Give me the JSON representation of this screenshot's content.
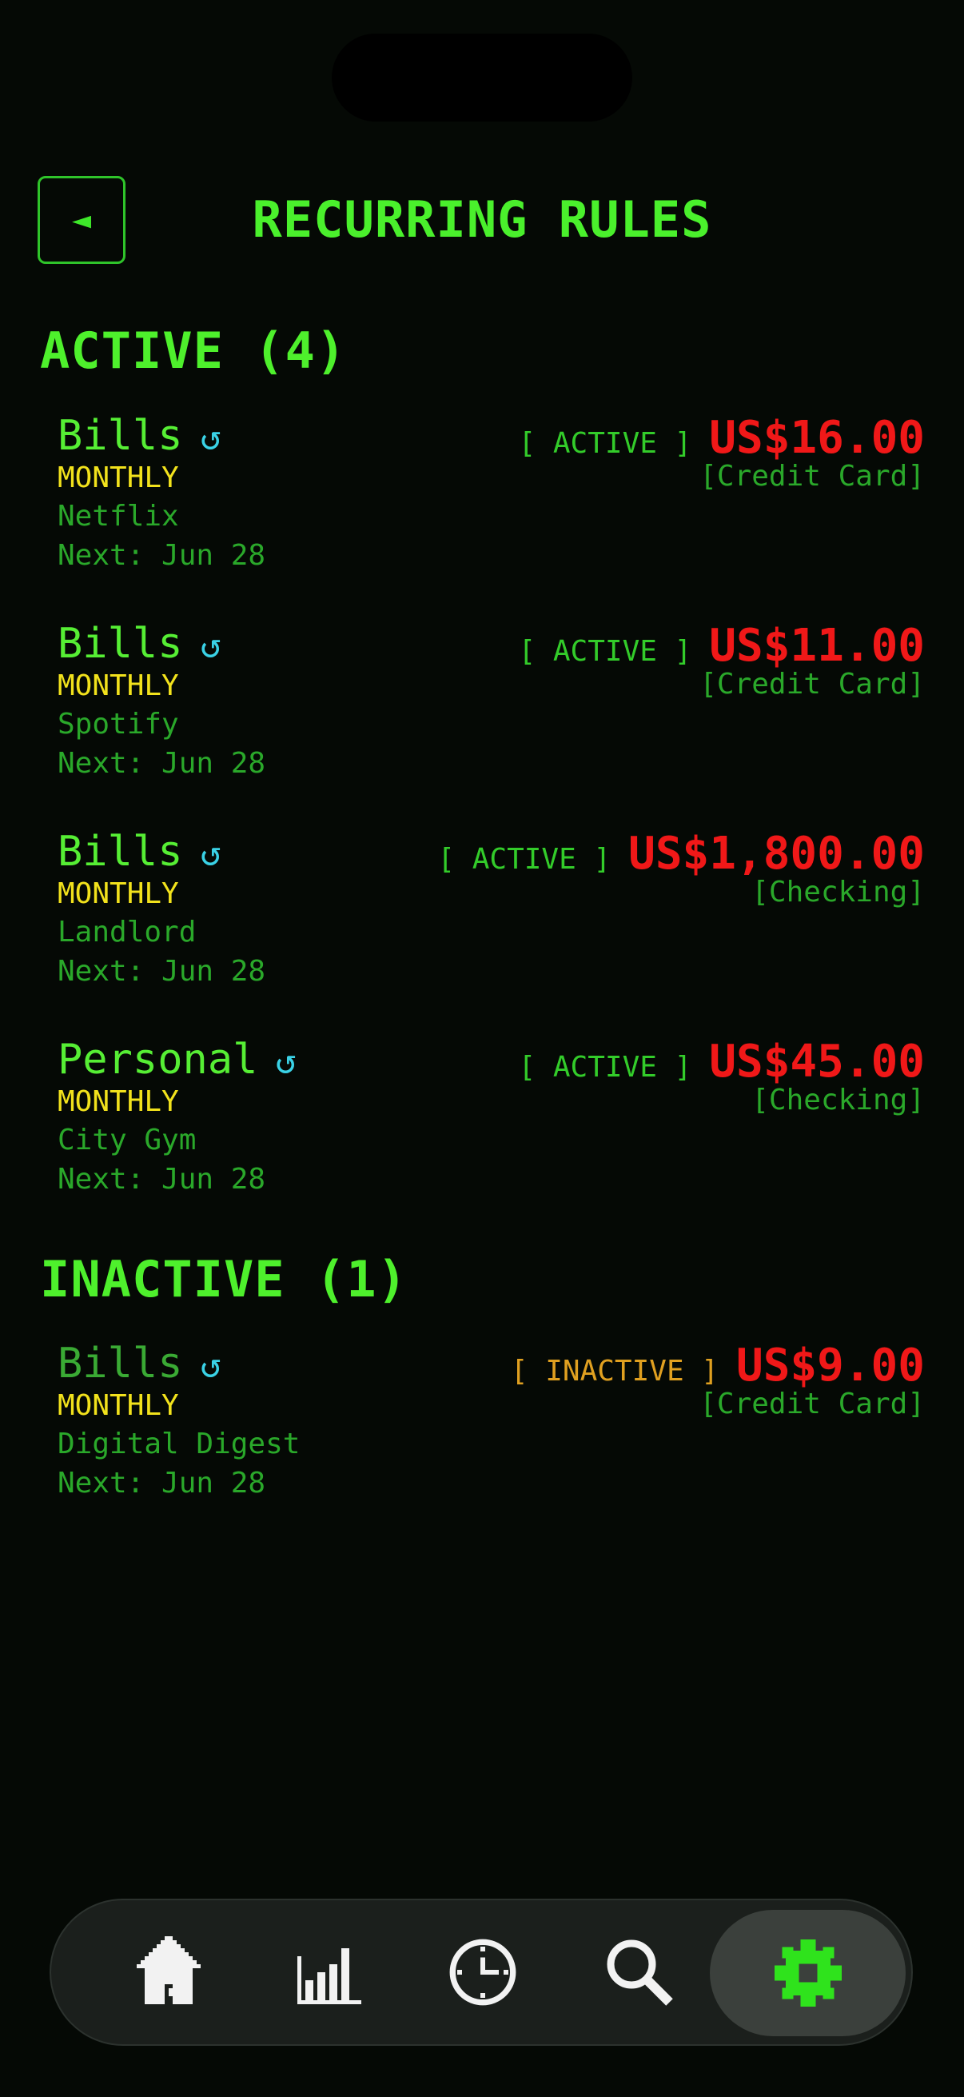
{
  "header": {
    "title": "RECURRING RULES",
    "back_icon": "◄"
  },
  "sections": {
    "active": {
      "title": "ACTIVE (4)",
      "rules": [
        {
          "category": "Bills",
          "frequency": "MONTHLY",
          "payee": "Netflix",
          "next": "Next: Jun 28",
          "status": "[ ACTIVE ]",
          "amount": "US$16.00",
          "account": "[Credit Card]"
        },
        {
          "category": "Bills",
          "frequency": "MONTHLY",
          "payee": "Spotify",
          "next": "Next: Jun 28",
          "status": "[ ACTIVE ]",
          "amount": "US$11.00",
          "account": "[Credit Card]"
        },
        {
          "category": "Bills",
          "frequency": "MONTHLY",
          "payee": "Landlord",
          "next": "Next: Jun 28",
          "status": "[ ACTIVE ]",
          "amount": "US$1,800.00",
          "account": "[Checking]"
        },
        {
          "category": "Personal",
          "frequency": "MONTHLY",
          "payee": "City Gym",
          "next": "Next: Jun 28",
          "status": "[ ACTIVE ]",
          "amount": "US$45.00",
          "account": "[Checking]"
        }
      ]
    },
    "inactive": {
      "title": "INACTIVE (1)",
      "rules": [
        {
          "category": "Bills",
          "frequency": "MONTHLY",
          "payee": "Digital Digest",
          "next": "Next: Jun 28",
          "status": "[ INACTIVE ]",
          "amount": "US$9.00",
          "account": "[Credit Card]"
        }
      ]
    }
  },
  "recurring_icon": "↺",
  "tabbar": {
    "tabs": [
      {
        "name": "home-icon"
      },
      {
        "name": "chart-icon"
      },
      {
        "name": "clock-icon"
      },
      {
        "name": "search-icon"
      },
      {
        "name": "gear-icon",
        "selected": true
      }
    ]
  },
  "colors": {
    "background": "#050905",
    "accent_green": "#4af02c",
    "amount_red": "#f01818",
    "frequency_yellow": "#f2e21c",
    "recurring_cyan": "#3ad2e6",
    "inactive_orange": "#e0a020"
  }
}
